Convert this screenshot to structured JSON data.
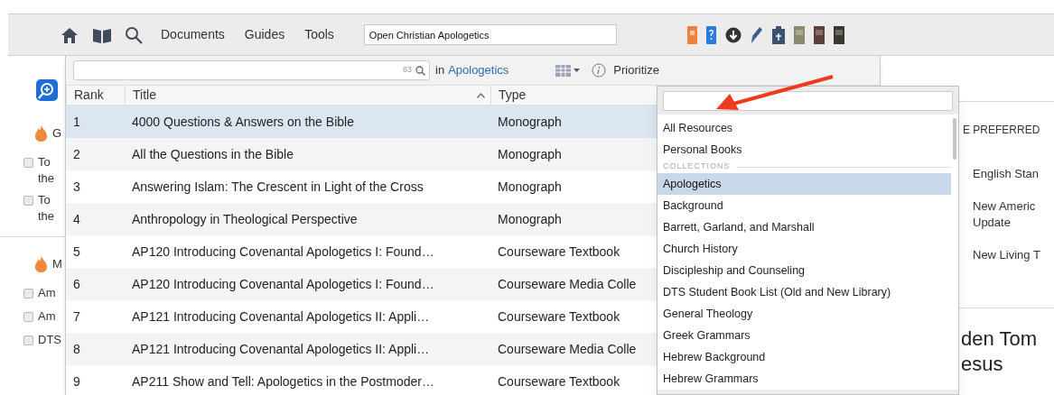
{
  "toolbar": {
    "nav_icons": [
      {
        "kind": "home"
      },
      {
        "kind": "library"
      },
      {
        "kind": "search"
      }
    ],
    "menus": [
      "Documents",
      "Guides",
      "Tools"
    ],
    "command_field": {
      "value": "Open Christian Apologetics"
    },
    "resource_icons": [
      {
        "kind": "book",
        "color": "#f0803a"
      },
      {
        "kind": "help",
        "color": "#2a7ae2"
      },
      {
        "kind": "download",
        "color": "#333333"
      },
      {
        "kind": "highlighter",
        "color": "#3c5f8a"
      },
      {
        "kind": "clipboard",
        "color": "#3c5070"
      },
      {
        "kind": "cover",
        "color": "#8a8a70"
      },
      {
        "kind": "cover",
        "color": "#5a4038"
      },
      {
        "kind": "cover",
        "color": "#383830"
      }
    ]
  },
  "background": {
    "left": [
      {
        "kind": "heading",
        "text": "G"
      },
      {
        "kind": "check",
        "text": "To",
        "checked": false
      },
      {
        "kind": "line",
        "text": "the"
      },
      {
        "kind": "check",
        "text": "To",
        "checked": false
      },
      {
        "kind": "line",
        "text": "the"
      },
      {
        "kind": "divider"
      },
      {
        "kind": "heading",
        "text": "M"
      },
      {
        "kind": "check",
        "text": "Am",
        "checked": false
      },
      {
        "kind": "check",
        "text": "Am",
        "checked": false
      },
      {
        "kind": "check",
        "text": "DTS",
        "checked": false
      }
    ],
    "right": [
      {
        "kind": "heading",
        "text": "E PREFERRED"
      },
      {
        "kind": "item",
        "text": "English Stan"
      },
      {
        "kind": "item",
        "text": "New Americ"
      },
      {
        "kind": "line",
        "text": "Update"
      },
      {
        "kind": "item",
        "text": "New Living T"
      },
      {
        "kind": "divider"
      },
      {
        "kind": "title",
        "text": "den Tom"
      },
      {
        "kind": "title",
        "text": "esus"
      }
    ]
  },
  "library": {
    "search": {
      "count": "83"
    },
    "scope_prefix": "in",
    "scope": "Apologetics",
    "prioritize": "Prioritize",
    "columns": [
      {
        "label": "Rank",
        "sorted": false
      },
      {
        "label": "Title",
        "sorted": true
      },
      {
        "label": "Type",
        "sorted": false
      }
    ],
    "rows": [
      {
        "rank": "1",
        "title": "4000 Questions & Answers on the Bible",
        "type": "Monograph",
        "selected": true
      },
      {
        "rank": "2",
        "title": "All the Questions in the Bible",
        "type": "Monograph",
        "selected": false
      },
      {
        "rank": "3",
        "title": "Answering Islam: The Crescent in Light of the Cross",
        "type": "Monograph",
        "selected": false
      },
      {
        "rank": "4",
        "title": "Anthropology in Theological Perspective",
        "type": "Monograph",
        "selected": false
      },
      {
        "rank": "5",
        "title": "AP120 Introducing Covenantal Apologetics I: Found…",
        "type": "Courseware Textbook",
        "selected": false
      },
      {
        "rank": "6",
        "title": "AP120 Introducing Covenantal Apologetics I: Found…",
        "type": "Courseware Media Colle",
        "selected": false
      },
      {
        "rank": "7",
        "title": "AP121 Introducing Covenantal Apologetics II: Appli…",
        "type": "Courseware Textbook",
        "selected": false
      },
      {
        "rank": "8",
        "title": "AP121 Introducing Covenantal Apologetics II: Appli…",
        "type": "Courseware Media Colle",
        "selected": false
      },
      {
        "rank": "9",
        "title": "AP211 Show and Tell: Apologetics in the Postmoder…",
        "type": "Courseware Textbook",
        "selected": false
      }
    ]
  },
  "scope_menu": {
    "items": [
      {
        "kind": "item",
        "label": "All Resources",
        "selected": false
      },
      {
        "kind": "item",
        "label": "Personal Books",
        "selected": false
      },
      {
        "kind": "header",
        "label": "COLLECTIONS"
      },
      {
        "kind": "item",
        "label": "Apologetics",
        "selected": true
      },
      {
        "kind": "item",
        "label": "Background",
        "selected": false
      },
      {
        "kind": "item",
        "label": "Barrett, Garland, and Marshall",
        "selected": false
      },
      {
        "kind": "item",
        "label": "Church History",
        "selected": false
      },
      {
        "kind": "item",
        "label": "Discipleship and Counseling",
        "selected": false
      },
      {
        "kind": "item",
        "label": "DTS Student Book List (Old and New Library)",
        "selected": false
      },
      {
        "kind": "item",
        "label": "General Theology",
        "selected": false
      },
      {
        "kind": "item",
        "label": "Greek Grammars",
        "selected": false
      },
      {
        "kind": "item",
        "label": "Hebrew Background",
        "selected": false
      },
      {
        "kind": "item",
        "label": "Hebrew Grammars",
        "selected": false
      }
    ]
  },
  "annotation": {
    "kind": "arrow",
    "color": "#f03a1e"
  }
}
